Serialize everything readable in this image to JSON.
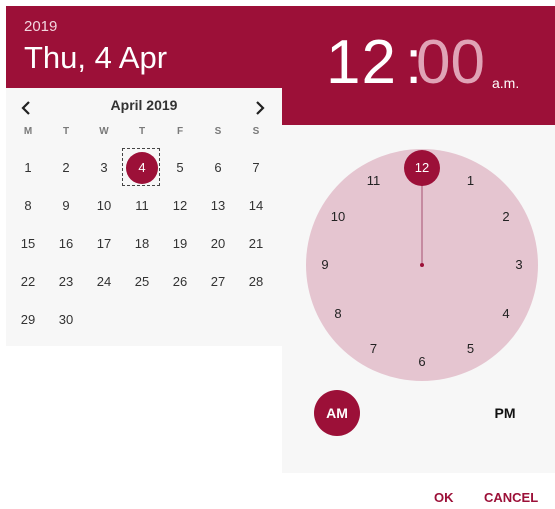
{
  "date_header": {
    "year": "2019",
    "title": "Thu, 4 Apr"
  },
  "calendar": {
    "month_label": "April 2019",
    "prev_icon": "chevron-left-icon",
    "next_icon": "chevron-right-icon",
    "weekdays": [
      "M",
      "T",
      "W",
      "T",
      "F",
      "S",
      "S"
    ],
    "weeks": [
      [
        "1",
        "2",
        "3",
        "4",
        "5",
        "6",
        "7"
      ],
      [
        "8",
        "9",
        "10",
        "11",
        "12",
        "13",
        "14"
      ],
      [
        "15",
        "16",
        "17",
        "18",
        "19",
        "20",
        "21"
      ],
      [
        "22",
        "23",
        "24",
        "25",
        "26",
        "27",
        "28"
      ],
      [
        "29",
        "30"
      ]
    ],
    "selected_day": "4"
  },
  "time_header": {
    "hours": "12",
    "separator": ":",
    "minutes": "00",
    "ampm": "a.m."
  },
  "clock": {
    "hours": [
      "12",
      "1",
      "2",
      "3",
      "4",
      "5",
      "6",
      "7",
      "8",
      "9",
      "10",
      "11"
    ],
    "selected_hour": "12"
  },
  "period": {
    "am_label": "AM",
    "pm_label": "PM",
    "selected": "AM"
  },
  "actions": {
    "ok_label": "OK",
    "cancel_label": "CANCEL"
  },
  "colors": {
    "accent": "#9c1038",
    "clock_face": "#e5c5d0",
    "minutes_text": "#e0a3b6"
  }
}
